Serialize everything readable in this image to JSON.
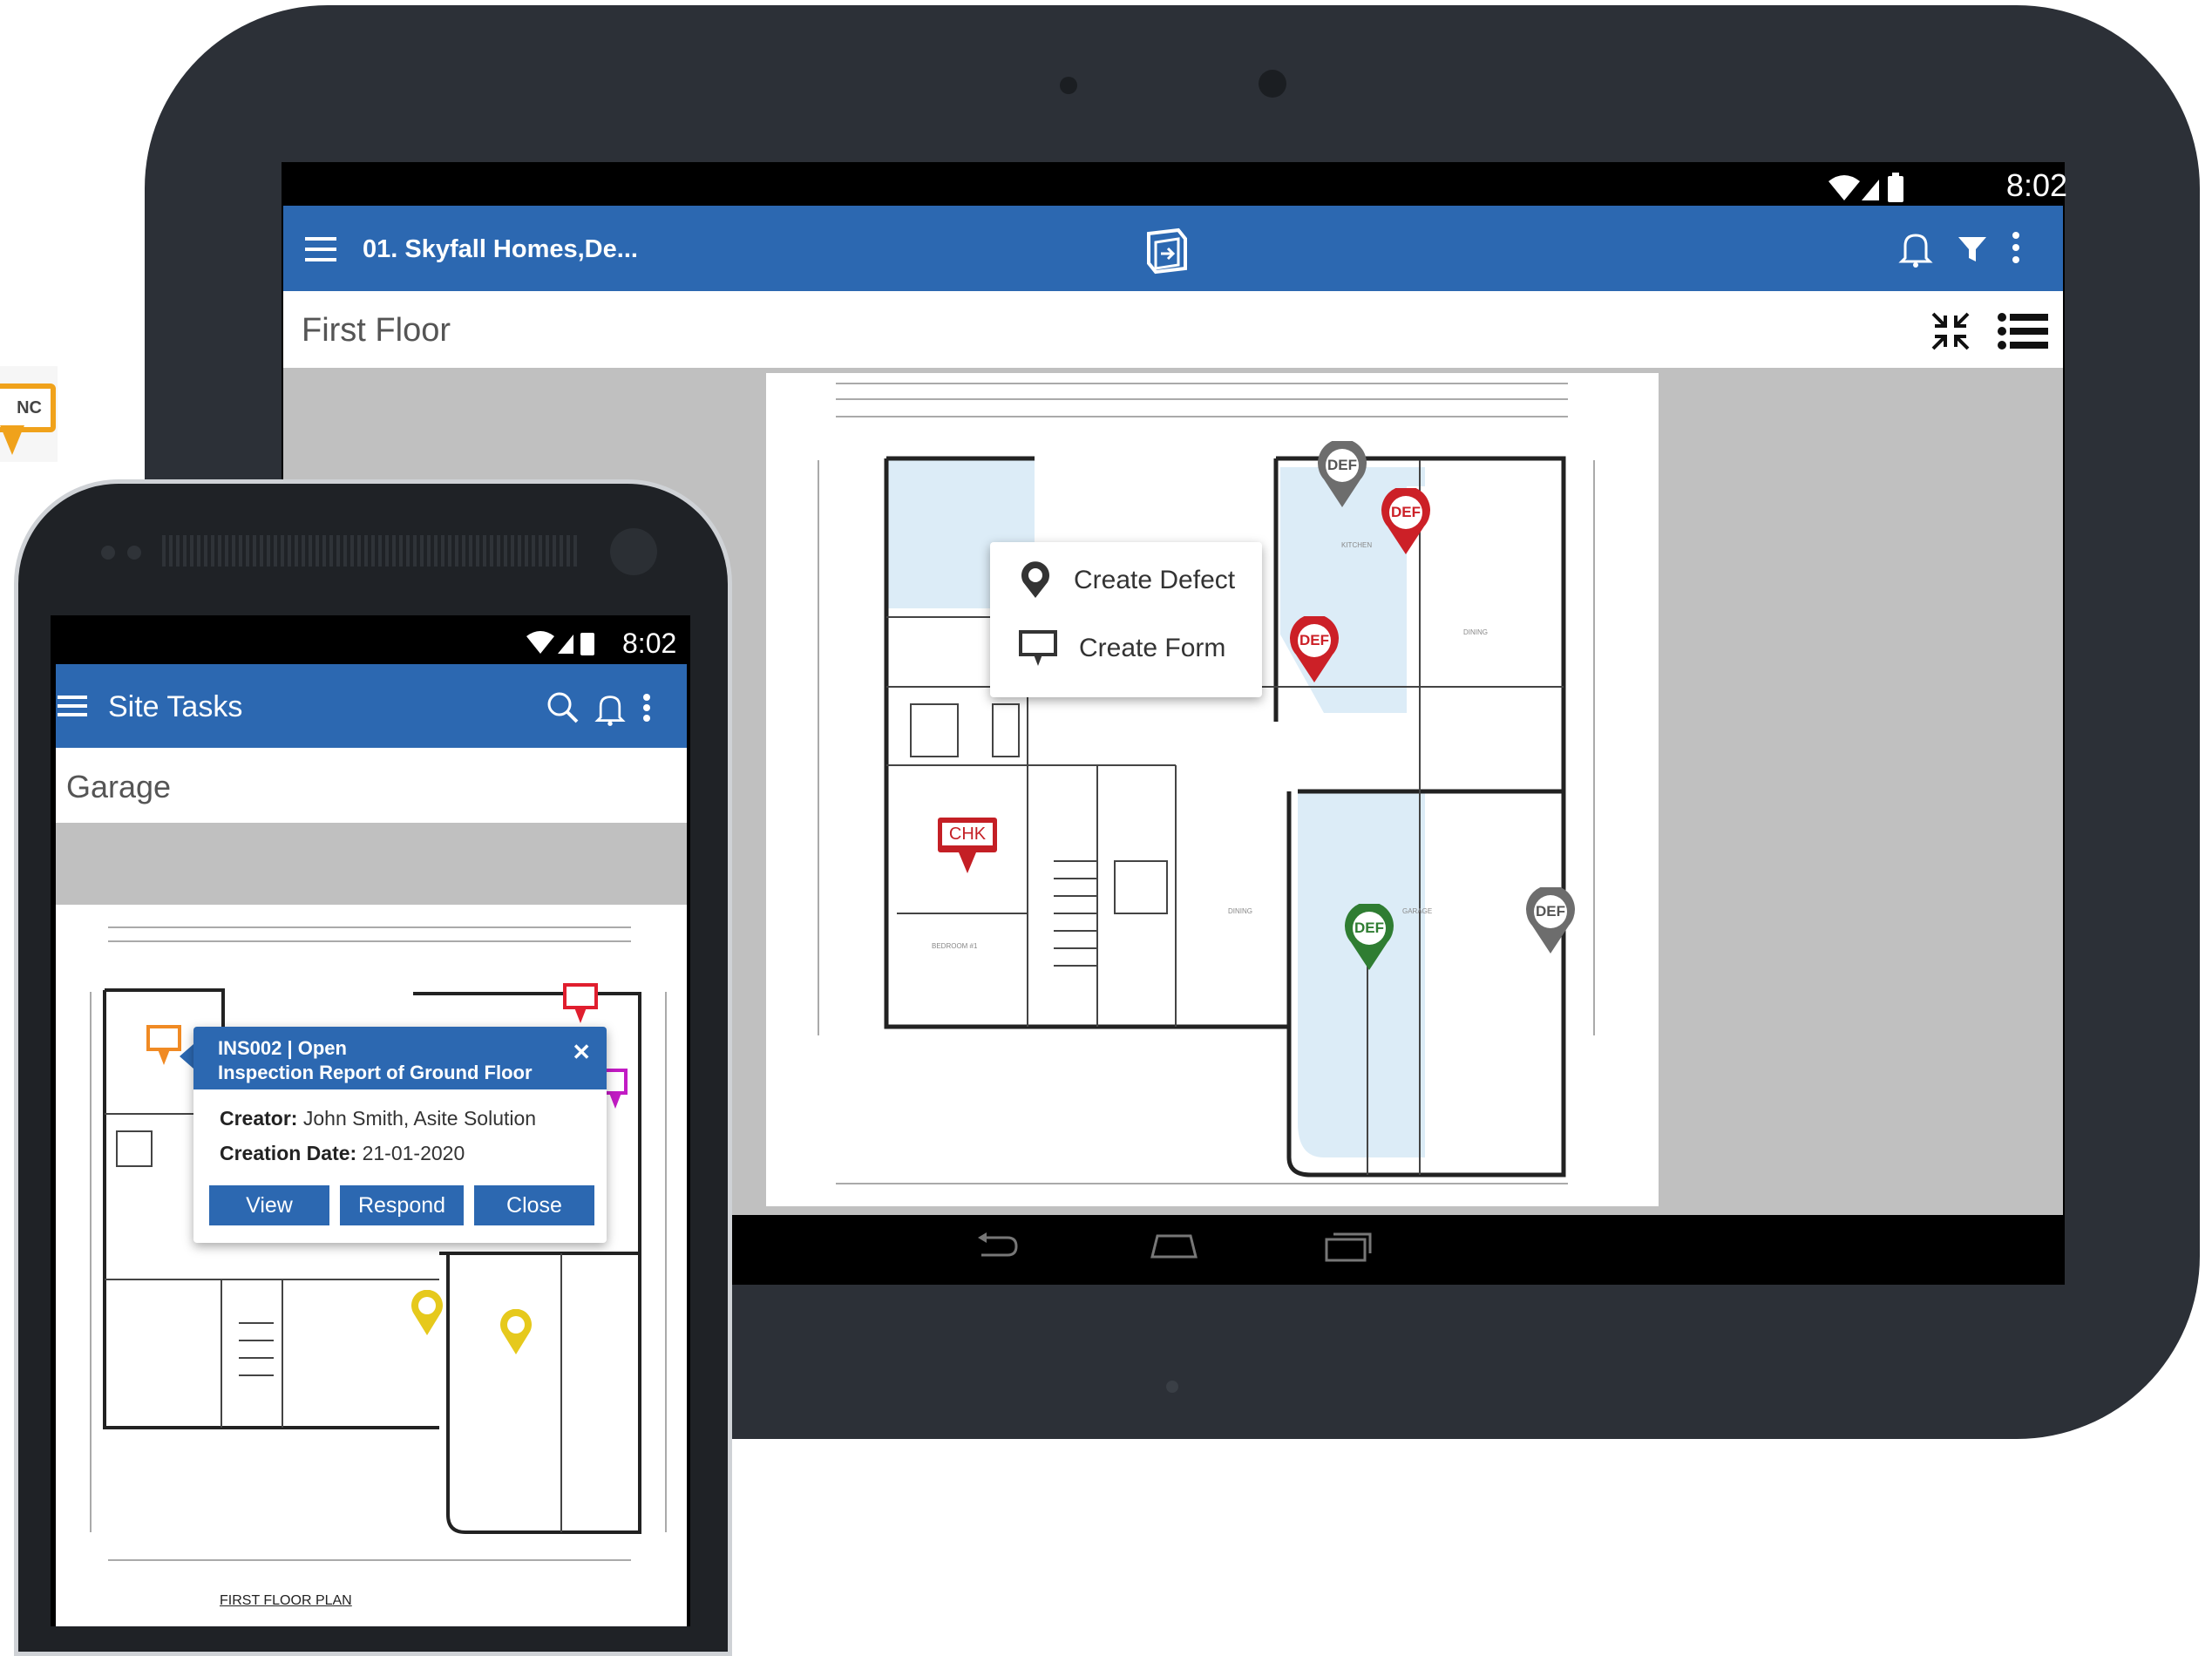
{
  "side_pin": {
    "label": "NC"
  },
  "tablet": {
    "status_time": "8:02",
    "app_title": "01. Skyfall Homes,De...",
    "page_title": "First Floor",
    "context_menu": {
      "create_defect": "Create Defect",
      "create_form": "Create Form"
    },
    "pins": [
      {
        "label": "DEF",
        "color": "#6d6d6d"
      },
      {
        "label": "DEF",
        "color": "#cc2027"
      },
      {
        "label": "DEF",
        "color": "#cc2027"
      },
      {
        "label": "DEF",
        "color": "#2f7d32"
      },
      {
        "label": "DEF",
        "color": "#6d6d6d"
      }
    ],
    "chk_label": "CHK"
  },
  "phone": {
    "status_time": "8:02",
    "app_title": "Site Tasks",
    "page_title": "Garage",
    "popup": {
      "line1": "INS002 | Open",
      "line2": "Inspection Report of Ground Floor",
      "creator_label": "Creator:",
      "creator_value": " John Smith, Asite Solution",
      "date_label": "Creation Date:",
      "date_value": " 21-01-2020",
      "view": "View",
      "respond": "Respond",
      "close": "Close"
    },
    "plan_caption": "FIRST FLOOR PLAN"
  },
  "colors": {
    "brand_blue": "#2c68b1",
    "bezel": "#2c3037"
  }
}
